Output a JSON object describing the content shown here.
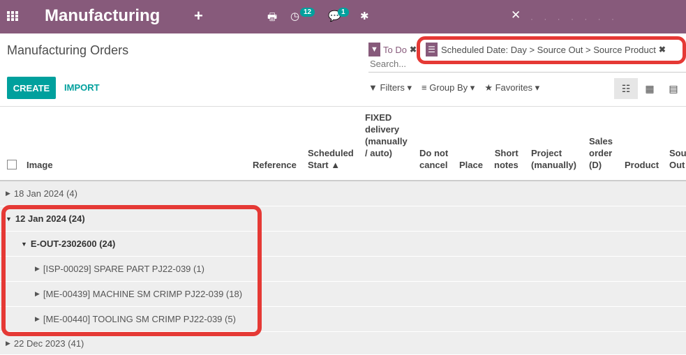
{
  "navbar": {
    "title": "Manufacturing",
    "plus": "+",
    "activity_badge": "12",
    "messages_badge": "1",
    "close_glyph": "✕"
  },
  "breadcrumb": "Manufacturing Orders",
  "search": {
    "facet_filter": "To Do",
    "facet_groupby": "Scheduled Date: Day > Source Out > Source Product",
    "placeholder": "Search..."
  },
  "buttons": {
    "create": "CREATE",
    "import": "IMPORT"
  },
  "search_options": {
    "filters": "Filters",
    "group_by": "Group By",
    "favorites": "Favorites"
  },
  "columns": {
    "image": "Image",
    "reference": "Reference",
    "scheduled_start_1": "Scheduled",
    "scheduled_start_2": "Start ▲",
    "fixed_1": "FIXED",
    "fixed_2": "delivery",
    "fixed_3": "(manually",
    "fixed_4": "/ auto)",
    "do_not_1": "Do not",
    "do_not_2": "cancel",
    "place": "Place",
    "short_1": "Short",
    "short_2": "notes",
    "project_1": "Project",
    "project_2": "(manually)",
    "sales_1": "Sales",
    "sales_2": "order",
    "sales_3": "(D)",
    "product": "Product",
    "source_1": "Sou",
    "source_2": "Out"
  },
  "groups": [
    {
      "label": "18 Jan 2024 (4)",
      "open": false
    },
    {
      "label": "12 Jan 2024 (24)",
      "open": true
    },
    {
      "label": "E-OUT-2302600 (24)",
      "open": true
    },
    {
      "label": "[ISP-00029] SPARE PART PJ22-039 (1)",
      "open": false
    },
    {
      "label": "[ME-00439] MACHINE SM CRIMP PJ22-039 (18)",
      "open": false
    },
    {
      "label": "[ME-00440] TOOLING SM CRIMP PJ22-039 (5)",
      "open": false
    },
    {
      "label": "22 Dec 2023 (41)",
      "open": false
    }
  ],
  "colors": {
    "brand": "#875a7b",
    "accent": "#00a09d",
    "highlight": "#e53935"
  }
}
